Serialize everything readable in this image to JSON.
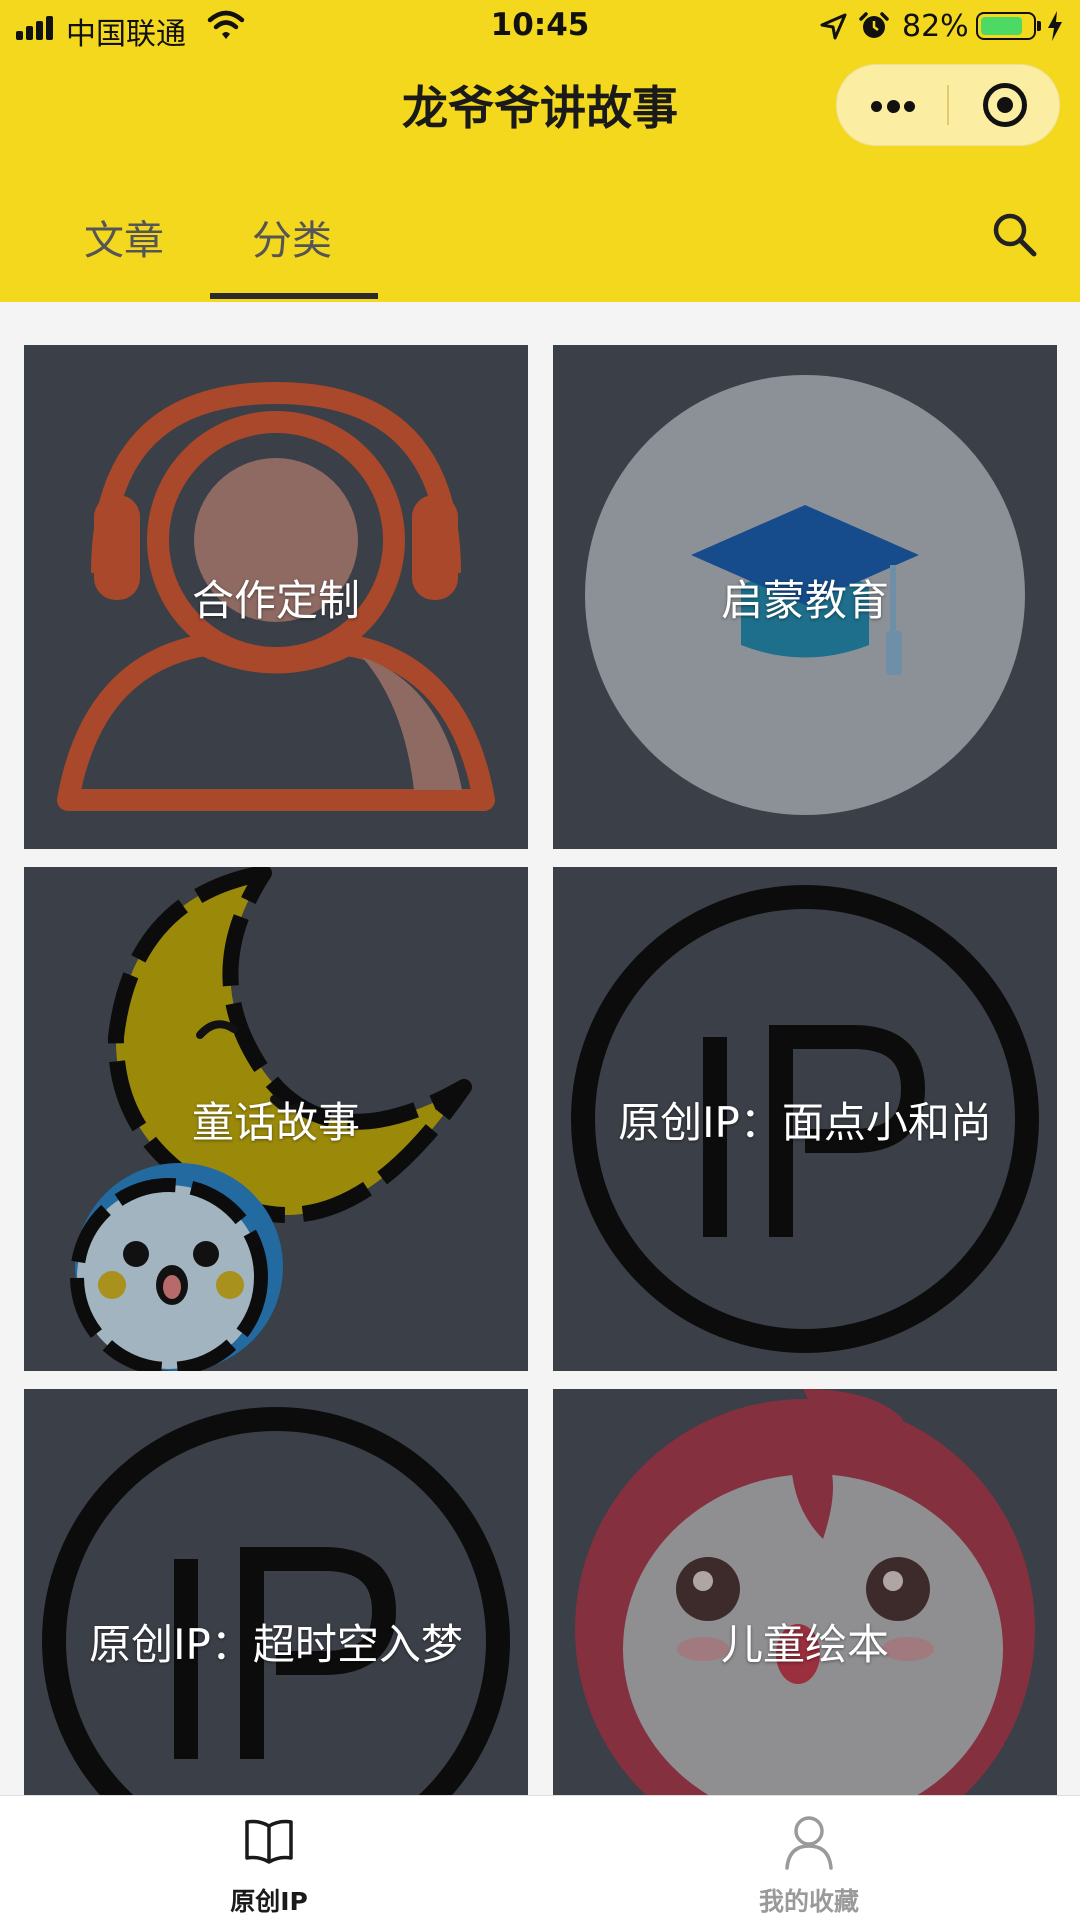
{
  "status_bar": {
    "carrier": "中国联通",
    "time": "10:45",
    "battery": "82%",
    "battery_level": 0.82,
    "icons": [
      "signal-icon",
      "wifi-icon",
      "location-icon",
      "alarm-icon",
      "battery-icon",
      "charging-icon"
    ]
  },
  "nav": {
    "title": "龙爷爷讲故事",
    "capsule_icons": [
      "more-icon",
      "close-icon"
    ]
  },
  "tabs": {
    "items": [
      {
        "label": "文章",
        "active": false
      },
      {
        "label": "分类",
        "active": true
      }
    ],
    "search_icon": "search-icon"
  },
  "categories": [
    {
      "label": "合作定制",
      "icon": "headset-person-icon"
    },
    {
      "label": "启蒙教育",
      "icon": "graduation-cap-icon"
    },
    {
      "label": "童话故事",
      "icon": "moon-icon"
    },
    {
      "label": "原创IP：面点小和尚",
      "icon": "ip-icon"
    },
    {
      "label": "原创IP：超时空入梦",
      "icon": "ip-icon"
    },
    {
      "label": "儿童绘本",
      "icon": "cartoon-face-icon"
    }
  ],
  "tabbar": {
    "items": [
      {
        "label": "原创IP",
        "icon": "book-icon",
        "active": true
      },
      {
        "label": "我的收藏",
        "icon": "user-icon",
        "active": false
      }
    ]
  },
  "colors": {
    "brand_yellow": "#f3d81e",
    "card_overlay": "#3b3f47",
    "active_text": "#1a1a1a",
    "inactive_text": "#9a9a9a"
  }
}
